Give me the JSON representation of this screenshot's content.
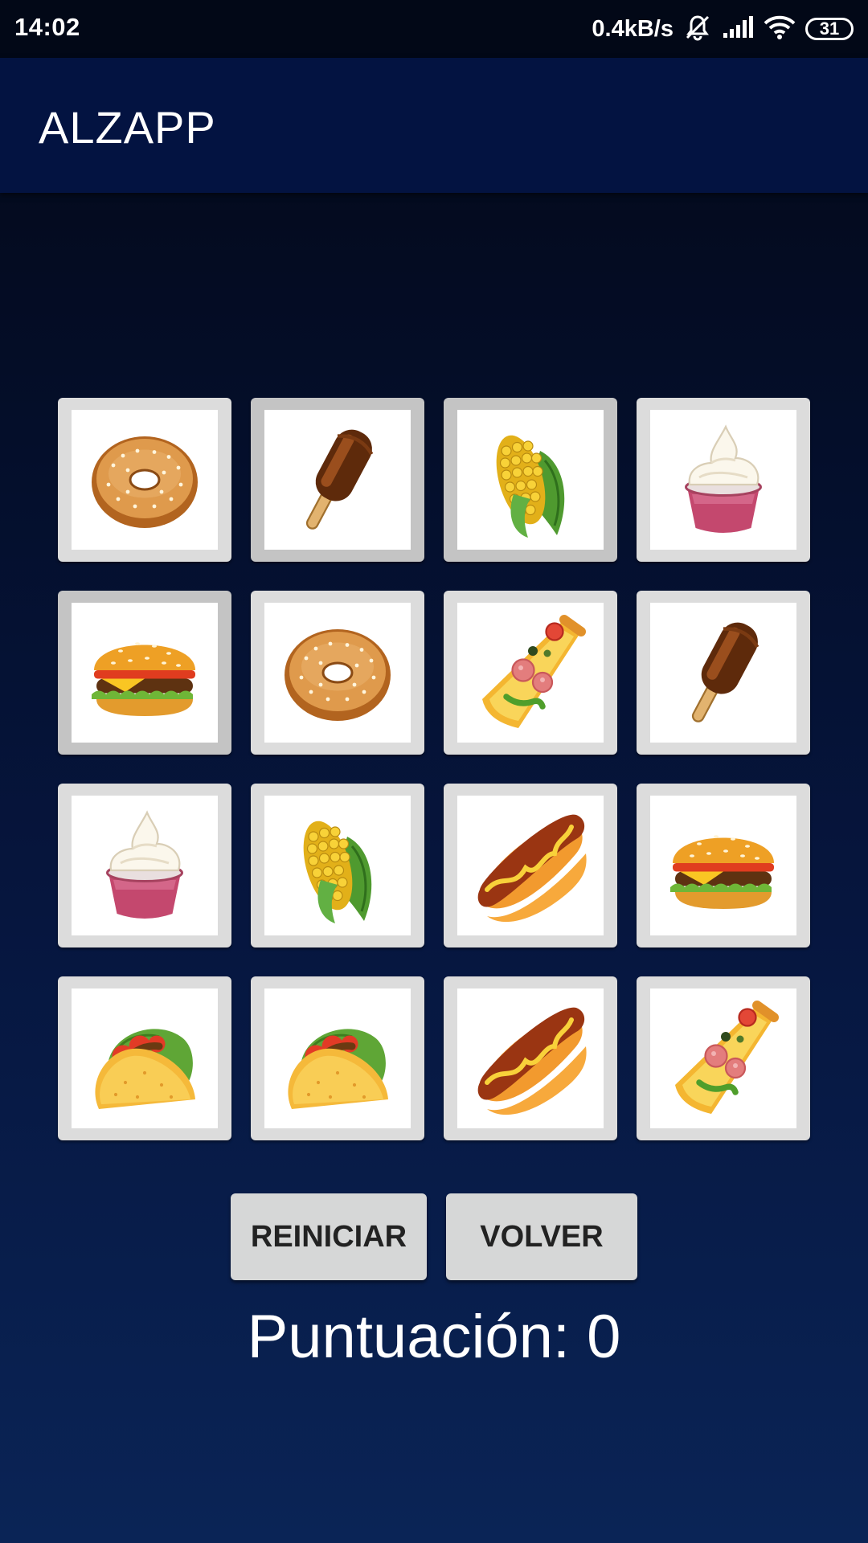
{
  "status_bar": {
    "time": "14:02",
    "network_speed": "0.4kB/s",
    "battery": "31",
    "icons": [
      "bell-muted-icon",
      "signal-icon",
      "wifi-icon",
      "battery-icon"
    ]
  },
  "app": {
    "title": "ALZAPP"
  },
  "board": {
    "rows": 4,
    "columns": 4,
    "cards": [
      {
        "food": "bagel",
        "icon": "bagel-icon"
      },
      {
        "food": "ice-cream-bar",
        "icon": "ice-cream-bar-icon"
      },
      {
        "food": "corn",
        "icon": "corn-icon"
      },
      {
        "food": "frozen-yogurt",
        "icon": "frozen-yogurt-icon"
      },
      {
        "food": "hamburger",
        "icon": "hamburger-icon"
      },
      {
        "food": "bagel",
        "icon": "bagel-icon"
      },
      {
        "food": "pizza",
        "icon": "pizza-icon"
      },
      {
        "food": "ice-cream-bar",
        "icon": "ice-cream-bar-icon"
      },
      {
        "food": "frozen-yogurt",
        "icon": "frozen-yogurt-icon"
      },
      {
        "food": "corn",
        "icon": "corn-icon"
      },
      {
        "food": "hot-dog",
        "icon": "hot-dog-icon"
      },
      {
        "food": "hamburger",
        "icon": "hamburger-icon"
      },
      {
        "food": "taco",
        "icon": "taco-icon"
      },
      {
        "food": "taco",
        "icon": "taco-icon"
      },
      {
        "food": "hot-dog",
        "icon": "hot-dog-icon"
      },
      {
        "food": "pizza",
        "icon": "pizza-icon"
      }
    ]
  },
  "buttons": {
    "restart": "REINICIAR",
    "back": "VOLVER"
  },
  "score": {
    "text": "Puntuación: 0",
    "value": 0
  },
  "colors": {
    "app_bar": "#031341",
    "status_bar": "#020817",
    "card_border": "#dcdcdc",
    "button": "#d6d7d7"
  }
}
